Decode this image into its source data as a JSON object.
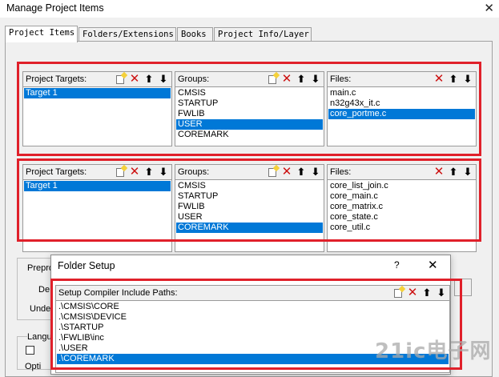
{
  "window": {
    "title": "Manage Project Items",
    "close_glyph": "✕"
  },
  "tabs": [
    {
      "label": "Project Items"
    },
    {
      "label": "Folders/Extensions"
    },
    {
      "label": "Books"
    },
    {
      "label": "Project Info/Layer"
    }
  ],
  "panel_top": {
    "targets": {
      "label": "Project Targets:",
      "items": [
        "Target 1"
      ],
      "selected_index": 0
    },
    "groups": {
      "label": "Groups:",
      "items": [
        "CMSIS",
        "STARTUP",
        "FWLIB",
        "USER",
        "COREMARK"
      ],
      "selected_index": 3
    },
    "files": {
      "label": "Files:",
      "items": [
        "main.c",
        "n32g43x_it.c",
        "core_portme.c"
      ],
      "selected_index": 2
    }
  },
  "panel_bottom": {
    "targets": {
      "label": "Project Targets:",
      "items": [
        "Target 1"
      ],
      "selected_index": 0
    },
    "groups": {
      "label": "Groups:",
      "items": [
        "CMSIS",
        "STARTUP",
        "FWLIB",
        "USER",
        "COREMARK"
      ],
      "selected_index": 4
    },
    "files": {
      "label": "Files:",
      "items": [
        "core_list_join.c",
        "core_main.c",
        "core_matrix.c",
        "core_state.c",
        "core_util.c"
      ],
      "selected_index": -1
    }
  },
  "partials": {
    "prepro": "Prepro",
    "de": "De",
    "unde": "Unde",
    "langu": "Langu",
    "opti": "Opti"
  },
  "folder_setup": {
    "title": "Folder Setup",
    "help_glyph": "?",
    "close_glyph": "✕",
    "label": "Setup Compiler Include Paths:",
    "items": [
      ".\\CMSIS\\CORE",
      ".\\CMSIS\\DEVICE",
      ".\\STARTUP",
      ".\\FWLIB\\inc",
      ".\\USER",
      ".\\COREMARK"
    ],
    "selected_index": 5
  },
  "watermark": "21ic电子网",
  "colors": {
    "highlight_red": "#e0202a",
    "selection_blue": "#0078d7"
  }
}
